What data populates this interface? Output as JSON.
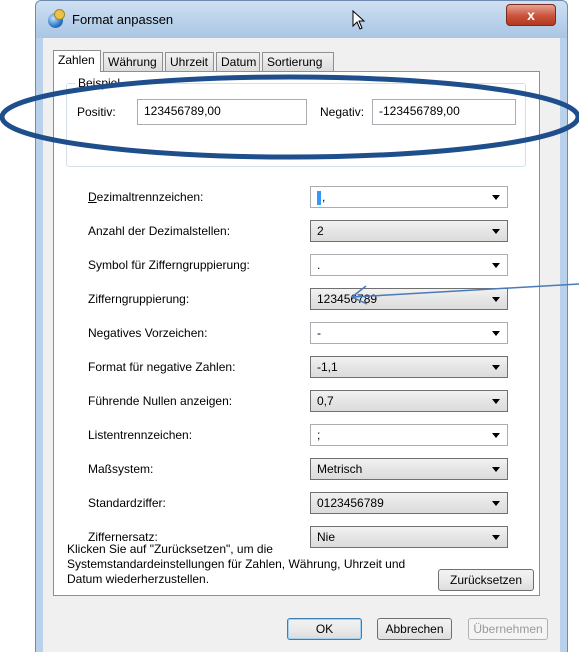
{
  "window": {
    "title": "Format anpassen",
    "close_label": "x"
  },
  "tabs": [
    {
      "label": "Zahlen",
      "active": true
    },
    {
      "label": "Währung",
      "active": false
    },
    {
      "label": "Uhrzeit",
      "active": false
    },
    {
      "label": "Datum",
      "active": false
    },
    {
      "label": "Sortierung",
      "active": false
    }
  ],
  "example": {
    "legend": "Beispiel",
    "positive_label": "Positiv:",
    "positive_value": "123456789,00",
    "negative_label": "Negativ:",
    "negative_value": "-123456789,00"
  },
  "settings": [
    {
      "label": "Dezimaltrennzeichen:",
      "value": ",",
      "editable": true
    },
    {
      "label": "Anzahl der Dezimalstellen:",
      "value": "2",
      "editable": false
    },
    {
      "label": "Symbol für Zifferngruppierung:",
      "value": ".",
      "editable": true
    },
    {
      "label": "Zifferngruppierung:",
      "value": "123456789",
      "editable": false
    },
    {
      "label": "Negatives Vorzeichen:",
      "value": "-",
      "editable": true
    },
    {
      "label": "Format für negative Zahlen:",
      "value": "-1,1",
      "editable": false
    },
    {
      "label": "Führende Nullen anzeigen:",
      "value": "0,7",
      "editable": false
    },
    {
      "label": "Listentrennzeichen:",
      "value": ";",
      "editable": true
    },
    {
      "label": "Maßsystem:",
      "value": "Metrisch",
      "editable": false
    },
    {
      "label": "Standardziffer:",
      "value": "0123456789",
      "editable": false
    },
    {
      "label": "Ziffernersatz:",
      "value": "Nie",
      "editable": false
    }
  ],
  "info_text": "Klicken Sie auf \"Zurücksetzen\", um die Systemstandardeinstellungen für Zahlen, Währung, Uhrzeit und Datum wiederherzustellen.",
  "buttons": {
    "reset": "Zurücksetzen",
    "ok": "OK",
    "cancel": "Abbrechen",
    "apply": "Übernehmen"
  },
  "annotation_color": "#1f4e8c",
  "arrow_color": "#4a7ab8"
}
